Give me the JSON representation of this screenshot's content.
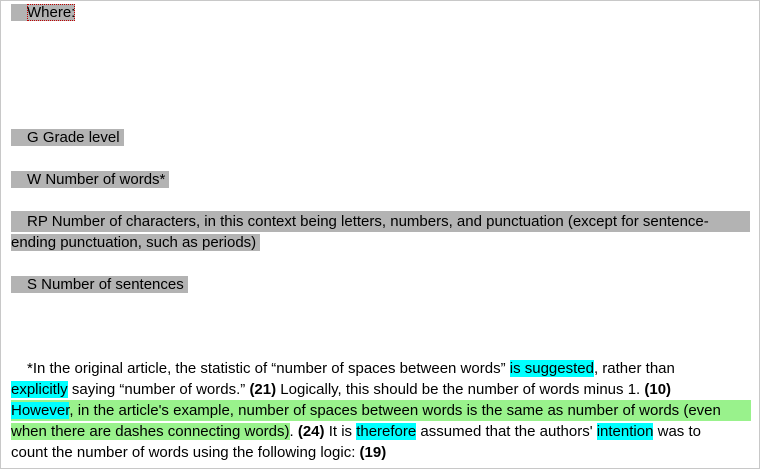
{
  "definitions": {
    "where": "Where:",
    "g": "G Grade level",
    "w": "W Number of words*",
    "rp_line1": "RP Number of characters, in this context being letters, numbers, and punctuation (except for sentence-",
    "rp_line2": "ending punctuation, such as periods)",
    "s": "S Number of sentences"
  },
  "footnote": {
    "r1_a": "*In the original article, the statistic of “number of spaces between words” ",
    "r1_b": "is suggested",
    "r1_c": ", rather than",
    "r2_a": "explicitly",
    "r2_b": " saying “number of words.” ",
    "r2_c": "(21)",
    "r2_d": "  Logically, this should be the number of words minus 1. ",
    "r2_e": "(10)",
    "r3_a": "However",
    "r3_b": ", in the article's example, number of spaces between words is the same as number of words (even",
    "r4_a": "when there are dashes connecting words)",
    "r4_b": ". ",
    "r4_c": "(24)",
    "r4_d": "  It is ",
    "r4_e": "therefore",
    "r4_f": " assumed that the authors' ",
    "r4_g": "intention",
    "r4_h": " was to",
    "r5_a": "count the number of words using the following logic: ",
    "r5_b": "(19)"
  },
  "colors": {
    "gray_highlight": "#b3b3b3",
    "cyan_highlight": "#00ffff",
    "green_highlight": "#99f28c"
  }
}
